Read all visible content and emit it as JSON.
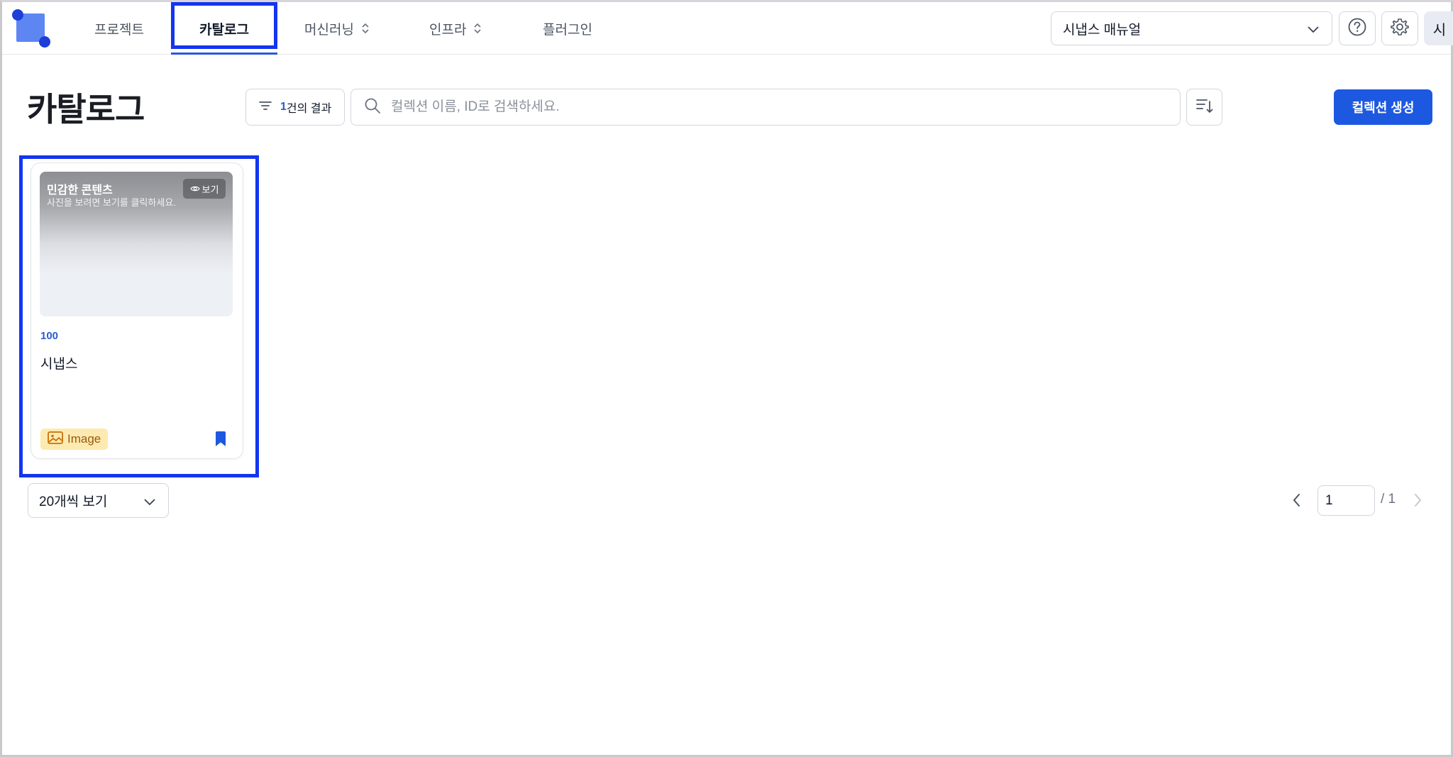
{
  "nav": {
    "items": [
      {
        "label": "프로젝트"
      },
      {
        "label": "카탈로그"
      },
      {
        "label": "머신러닝"
      },
      {
        "label": "인프라"
      },
      {
        "label": "플러그인"
      }
    ],
    "active": "카탈로그",
    "manual_select": "시냅스 매뉴얼",
    "avatar_label": "시",
    "icons": [
      "logo",
      "help-icon",
      "gear-icon"
    ]
  },
  "page": {
    "title": "카탈로그",
    "filter_count": "1",
    "filter_text": "건의 결과",
    "search_placeholder": "컬렉션 이름, ID로 검색하세요.",
    "create_button": "컬렉션 생성"
  },
  "cards": [
    {
      "thumb_title": "민감한 콘텐츠",
      "thumb_desc": "사진을 보려면 보기를 클릭하세요.",
      "view_label": "보기",
      "id": "100",
      "name": "시냅스",
      "type": "Image"
    }
  ],
  "pagination": {
    "page_size": "20개씩 보기",
    "current": "1",
    "total": "/ 1"
  },
  "colors": {
    "accent": "#1d59e0",
    "highlight": "#1435f0",
    "badge_bg": "#fdeab0"
  }
}
